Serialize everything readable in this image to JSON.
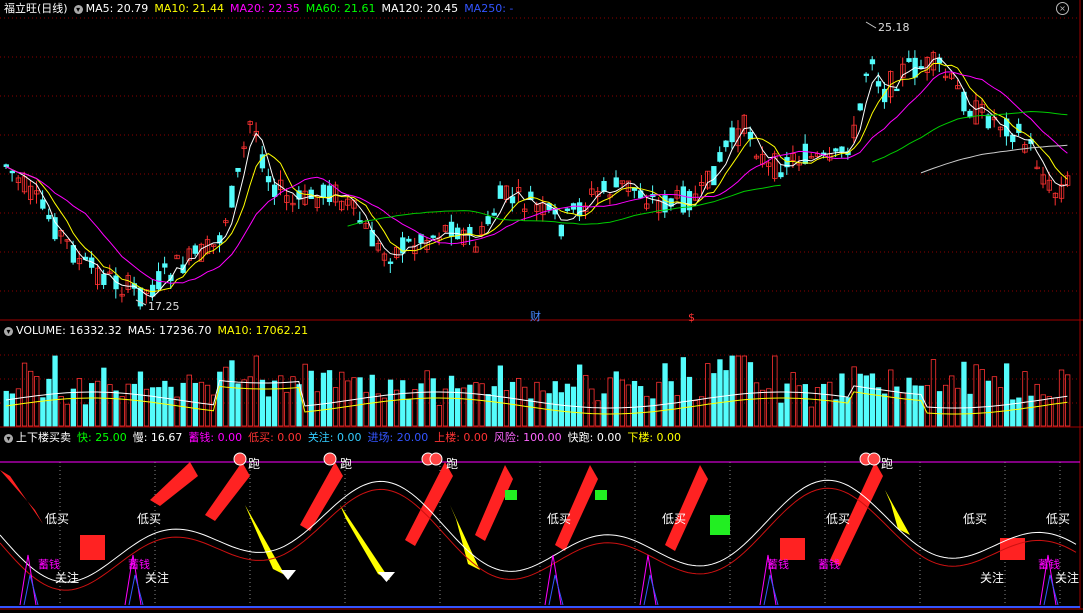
{
  "panels": {
    "price": {
      "title": "福立旺(日线)",
      "indicators": [
        {
          "label": "MA5: 20.79",
          "color": "#ffffff"
        },
        {
          "label": "MA10: 21.44",
          "color": "#ffff00"
        },
        {
          "label": "MA20: 22.35",
          "color": "#ff00ff"
        },
        {
          "label": "MA60: 21.61",
          "color": "#00ff00"
        },
        {
          "label": "MA120: 20.45",
          "color": "#ffffff"
        },
        {
          "label": "MA250: -",
          "color": "#3355ff"
        }
      ],
      "high_label": "25.18",
      "low_label": "17.25",
      "marker_cai": "财",
      "marker_s": "$"
    },
    "volume": {
      "indicators": [
        {
          "label": "VOLUME: 16332.32",
          "color": "#ffffff"
        },
        {
          "label": "MA5: 17236.70",
          "color": "#ffffff"
        },
        {
          "label": "MA10: 17062.21",
          "color": "#ffff00"
        }
      ]
    },
    "signal": {
      "title": "上下楼买卖",
      "indicators": [
        {
          "label": "快: 25.00",
          "color": "#00ff00"
        },
        {
          "label": "慢: 16.67",
          "color": "#ffffff"
        },
        {
          "label": "蓄钱: 0.00",
          "color": "#ff00ff"
        },
        {
          "label": "低买: 0.00",
          "color": "#ff3333"
        },
        {
          "label": "关注: 0.00",
          "color": "#33ccff"
        },
        {
          "label": "进场: 20.00",
          "color": "#3355ff"
        },
        {
          "label": "上楼: 0.00",
          "color": "#ff3333"
        },
        {
          "label": "风险: 100.00",
          "color": "#ff66ff"
        },
        {
          "label": "快跑: 0.00",
          "color": "#ffffff"
        },
        {
          "label": "下楼: 0.00",
          "color": "#ffff00"
        }
      ],
      "labels": {
        "run": "跑",
        "low_buy": "低买",
        "save": "蓄钱",
        "watch": "关注"
      }
    }
  },
  "colors": {
    "up": "#ff3232",
    "down": "#54fcfc",
    "grid": "#8b0000"
  }
}
